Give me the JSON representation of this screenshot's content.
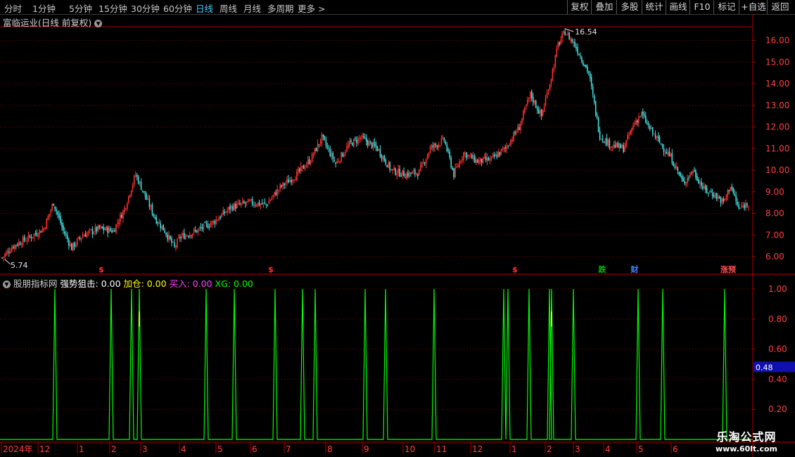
{
  "toolbar": {
    "timeframes": [
      "分时",
      "1分钟",
      "5分钟",
      "15分钟",
      "30分钟",
      "60分钟",
      "日线",
      "周线",
      "月线",
      "多周期",
      "更多 >"
    ],
    "active_timeframe": "日线",
    "right_buttons": [
      "复权",
      "叠加",
      "多股",
      "统计",
      "画线",
      "F10",
      "标记",
      "+自选",
      "返回"
    ]
  },
  "main_chart": {
    "title": "富临运业(日线 前复权)",
    "high_label": "16.54",
    "low_label": "5.74",
    "price_ticks": [
      "16.00",
      "15.00",
      "14.00",
      "13.00",
      "12.00",
      "11.00",
      "10.00",
      "9.00",
      "8.00",
      "7.00",
      "6.00"
    ],
    "markers": [
      {
        "text": "$",
        "color": "#ff3030"
      },
      {
        "text": "$",
        "color": "#ff3030"
      },
      {
        "text": "$",
        "color": "#ff3030"
      },
      {
        "text": "跌",
        "color": "#00c000"
      },
      {
        "text": "财",
        "color": "#4080ff"
      },
      {
        "text": "涨预",
        "color": "#ff5050"
      }
    ]
  },
  "indicator": {
    "name": "股朋指标网",
    "values": [
      {
        "label": "强势狙击:",
        "value": "0.00",
        "color": "#ffffff"
      },
      {
        "label": "加仓:",
        "value": "0.00",
        "color": "#ffff00"
      },
      {
        "label": "买入:",
        "value": "0.00",
        "color": "#ff40ff"
      },
      {
        "label": "XG:",
        "value": "0.00",
        "color": "#00ff00"
      }
    ],
    "y_ticks": [
      "1.00",
      "0.80",
      "0.60",
      "0.40",
      "0.20"
    ],
    "current_value": "0.48"
  },
  "x_axis": {
    "labels": [
      "2024年",
      "12",
      "1",
      "2",
      "3",
      "4",
      "5",
      "6",
      "7",
      "8",
      "9",
      "10",
      "11",
      "12",
      "1",
      "2",
      "3",
      "4",
      "5",
      "6"
    ]
  },
  "watermark": {
    "line1": "乐淘公式网",
    "line2": "www.60lt.com"
  },
  "colors": {
    "up": "#ff3030",
    "down": "#40e0e0",
    "signal": "#00ff00",
    "grid": "#8b0000",
    "axis": "#b00000"
  }
}
